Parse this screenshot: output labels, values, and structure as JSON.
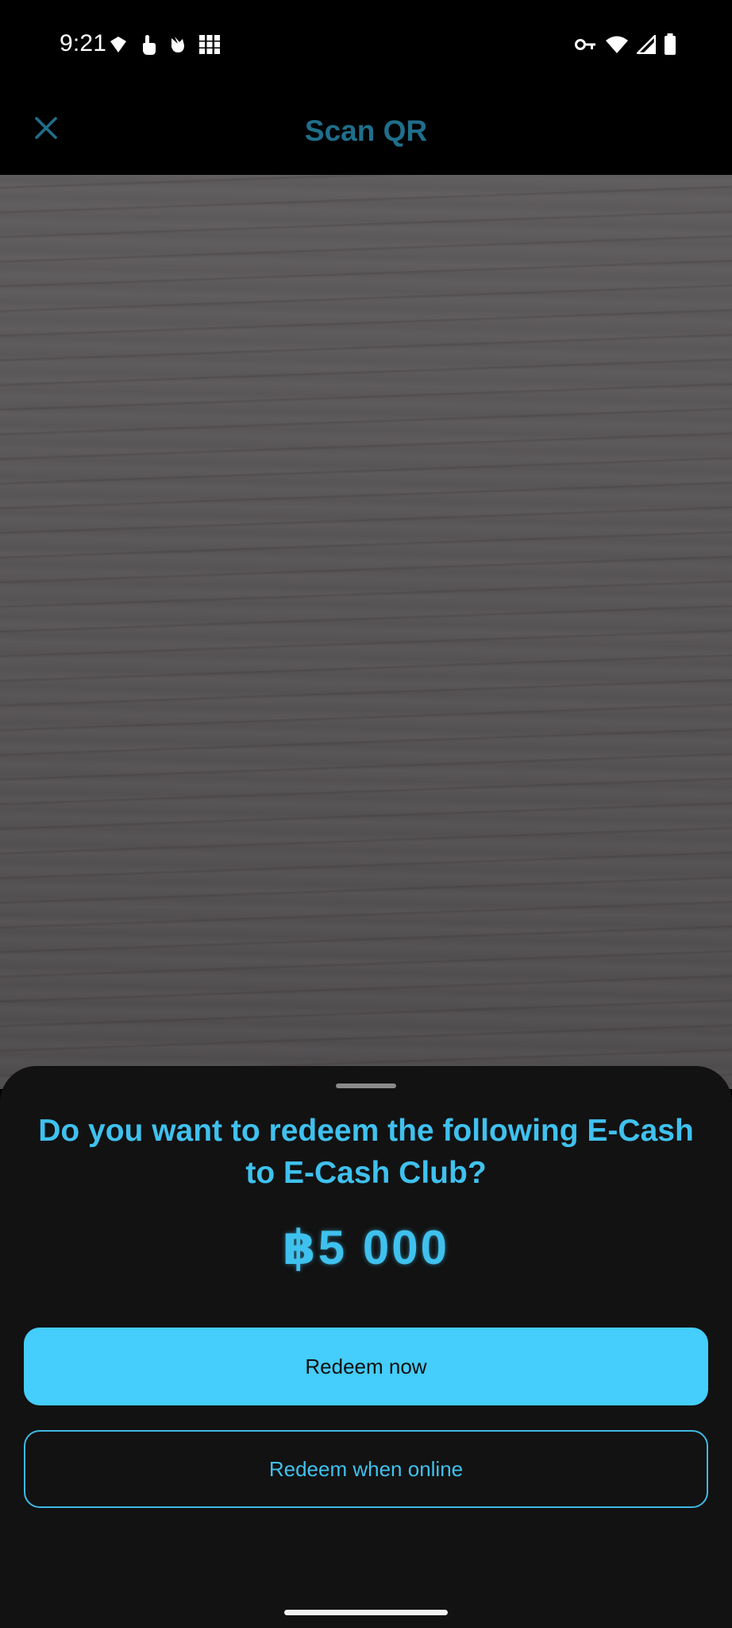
{
  "status_bar": {
    "time": "9:21",
    "left_icons": [
      "shield-icon",
      "touch-icon",
      "hand-icon",
      "grid-icon"
    ],
    "right_icons": [
      "key-icon",
      "wifi-icon",
      "signal-icon",
      "battery-icon"
    ]
  },
  "app_bar": {
    "title": "Scan QR",
    "close_icon": "close-icon",
    "title_color": "#1f6f8b"
  },
  "sheet": {
    "question": "Do you want to redeem the following E-Cash to E-Cash Club?",
    "amount": "฿5 000",
    "primary_button": "Redeem now",
    "secondary_button": "Redeem when online"
  },
  "colors": {
    "accent": "#3fc1ee",
    "primary_button_bg": "#45cdfb",
    "sheet_bg": "#121212"
  }
}
